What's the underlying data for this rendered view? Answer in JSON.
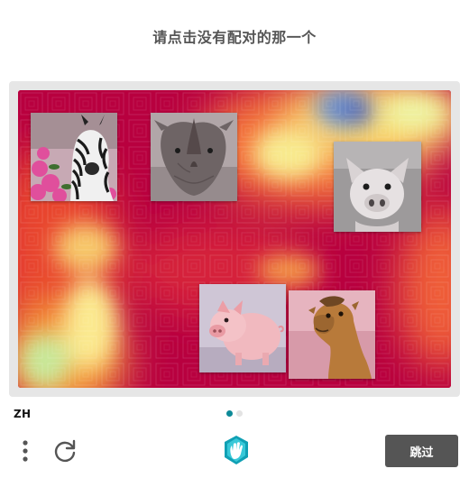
{
  "prompt": "请点击没有配对的那一个",
  "puzzle": {
    "tiles": [
      {
        "id": "zebra",
        "animal": "zebra",
        "label": "zebra with pink flowers"
      },
      {
        "id": "rhino",
        "animal": "rhino",
        "label": "rhino"
      },
      {
        "id": "pig-top",
        "animal": "pig",
        "label": "pig"
      },
      {
        "id": "pig-bottom",
        "animal": "pig",
        "label": "pig"
      },
      {
        "id": "camel",
        "animal": "camel",
        "label": "camel"
      }
    ]
  },
  "footer": {
    "language": "ZH",
    "pagination": {
      "current": 1,
      "total": 2
    },
    "menu_icon": "vertical-dots-icon",
    "refresh_icon": "refresh-icon",
    "logo_icon": "hand-logo-icon",
    "skip_label": "跳过"
  },
  "colors": {
    "accent": "#0d8a98",
    "button_bg": "#555555",
    "prompt_text": "#555555"
  }
}
